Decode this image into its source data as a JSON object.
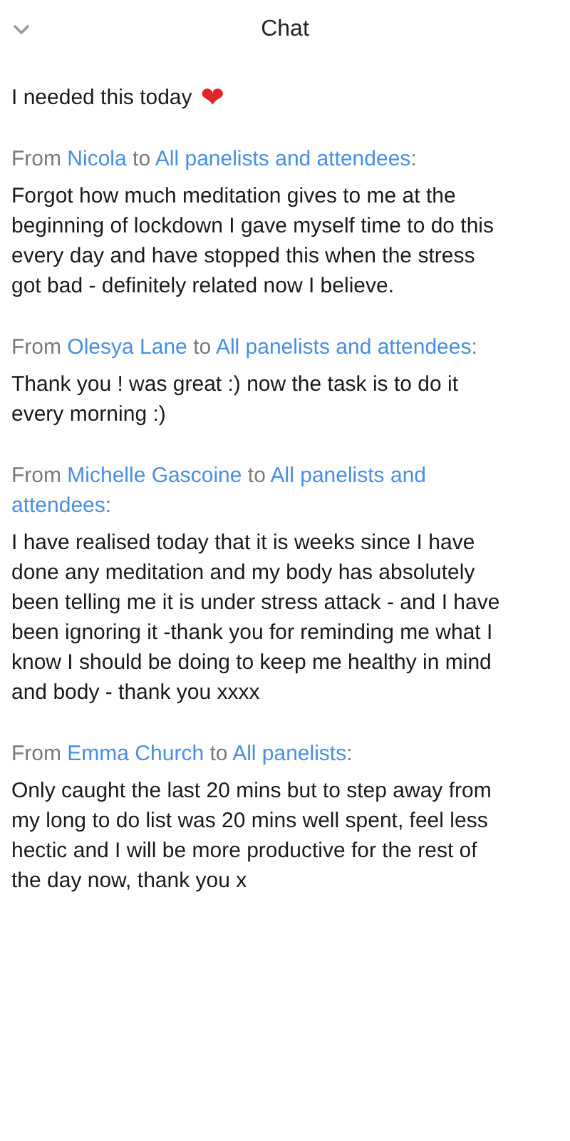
{
  "header": {
    "title": "Chat"
  },
  "messages": [
    {
      "text": "I needed this today",
      "emoji": "❤"
    },
    {
      "prefix": "From",
      "sender": "Nicola",
      "connector": "to",
      "recipient": "All panelists and attendees",
      "suffix": ":",
      "text": "Forgot how much meditation gives to me at the beginning of lockdown I gave myself time to do this every day and have stopped this when the stress got bad - definitely related now I believe."
    },
    {
      "prefix": "From",
      "sender": "Olesya Lane",
      "connector": "to",
      "recipient": "All panelists and attendees",
      "suffix": ":",
      "text": "Thank you ! was great :) now the task is to do it every morning :)"
    },
    {
      "prefix": "From",
      "sender": "Michelle Gascoine",
      "connector": "to",
      "recipient": "All panelists and attendees",
      "suffix": ":",
      "text": "I have realised today that it is weeks since I have done any meditation and my body has absolutely been telling me it is under stress attack - and I have been ignoring it -thank you for reminding me what I know I should be doing to keep me healthy in mind and body - thank you xxxx"
    },
    {
      "prefix": "From",
      "sender": "Emma Church",
      "connector": "to",
      "recipient": "All panelists",
      "suffix": ":",
      "text": "Only caught the last 20 mins but to step away from my long to do list was 20 mins well spent, feel less hectic and I will be more productive for the rest of the day now, thank you x"
    }
  ]
}
